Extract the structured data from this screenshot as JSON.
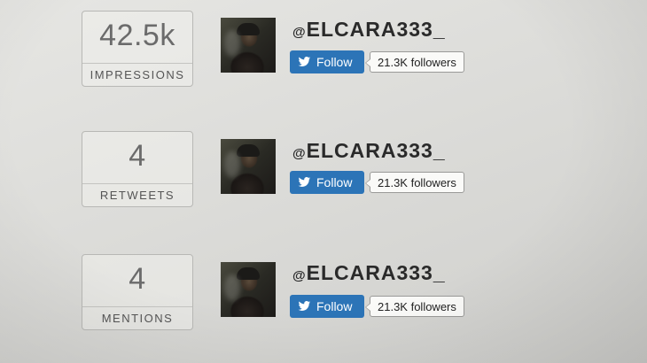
{
  "rows": [
    {
      "stat": {
        "value": "42.5k",
        "label": "IMPRESSIONS"
      },
      "user": {
        "at": "@",
        "handle": "ELCARA333_",
        "follow_label": "Follow",
        "followers": "21.3K followers"
      }
    },
    {
      "stat": {
        "value": "4",
        "label": "RETWEETS"
      },
      "user": {
        "at": "@",
        "handle": "ELCARA333_",
        "follow_label": "Follow",
        "followers": "21.3K followers"
      }
    },
    {
      "stat": {
        "value": "4",
        "label": "MENTIONS"
      },
      "user": {
        "at": "@",
        "handle": "ELCARA333_",
        "follow_label": "Follow",
        "followers": "21.3K followers"
      }
    }
  ],
  "icons": {
    "follow": "twitter-bird-icon"
  },
  "colors": {
    "follow_button": "#2c74b7",
    "background": "#dcdcd9"
  }
}
